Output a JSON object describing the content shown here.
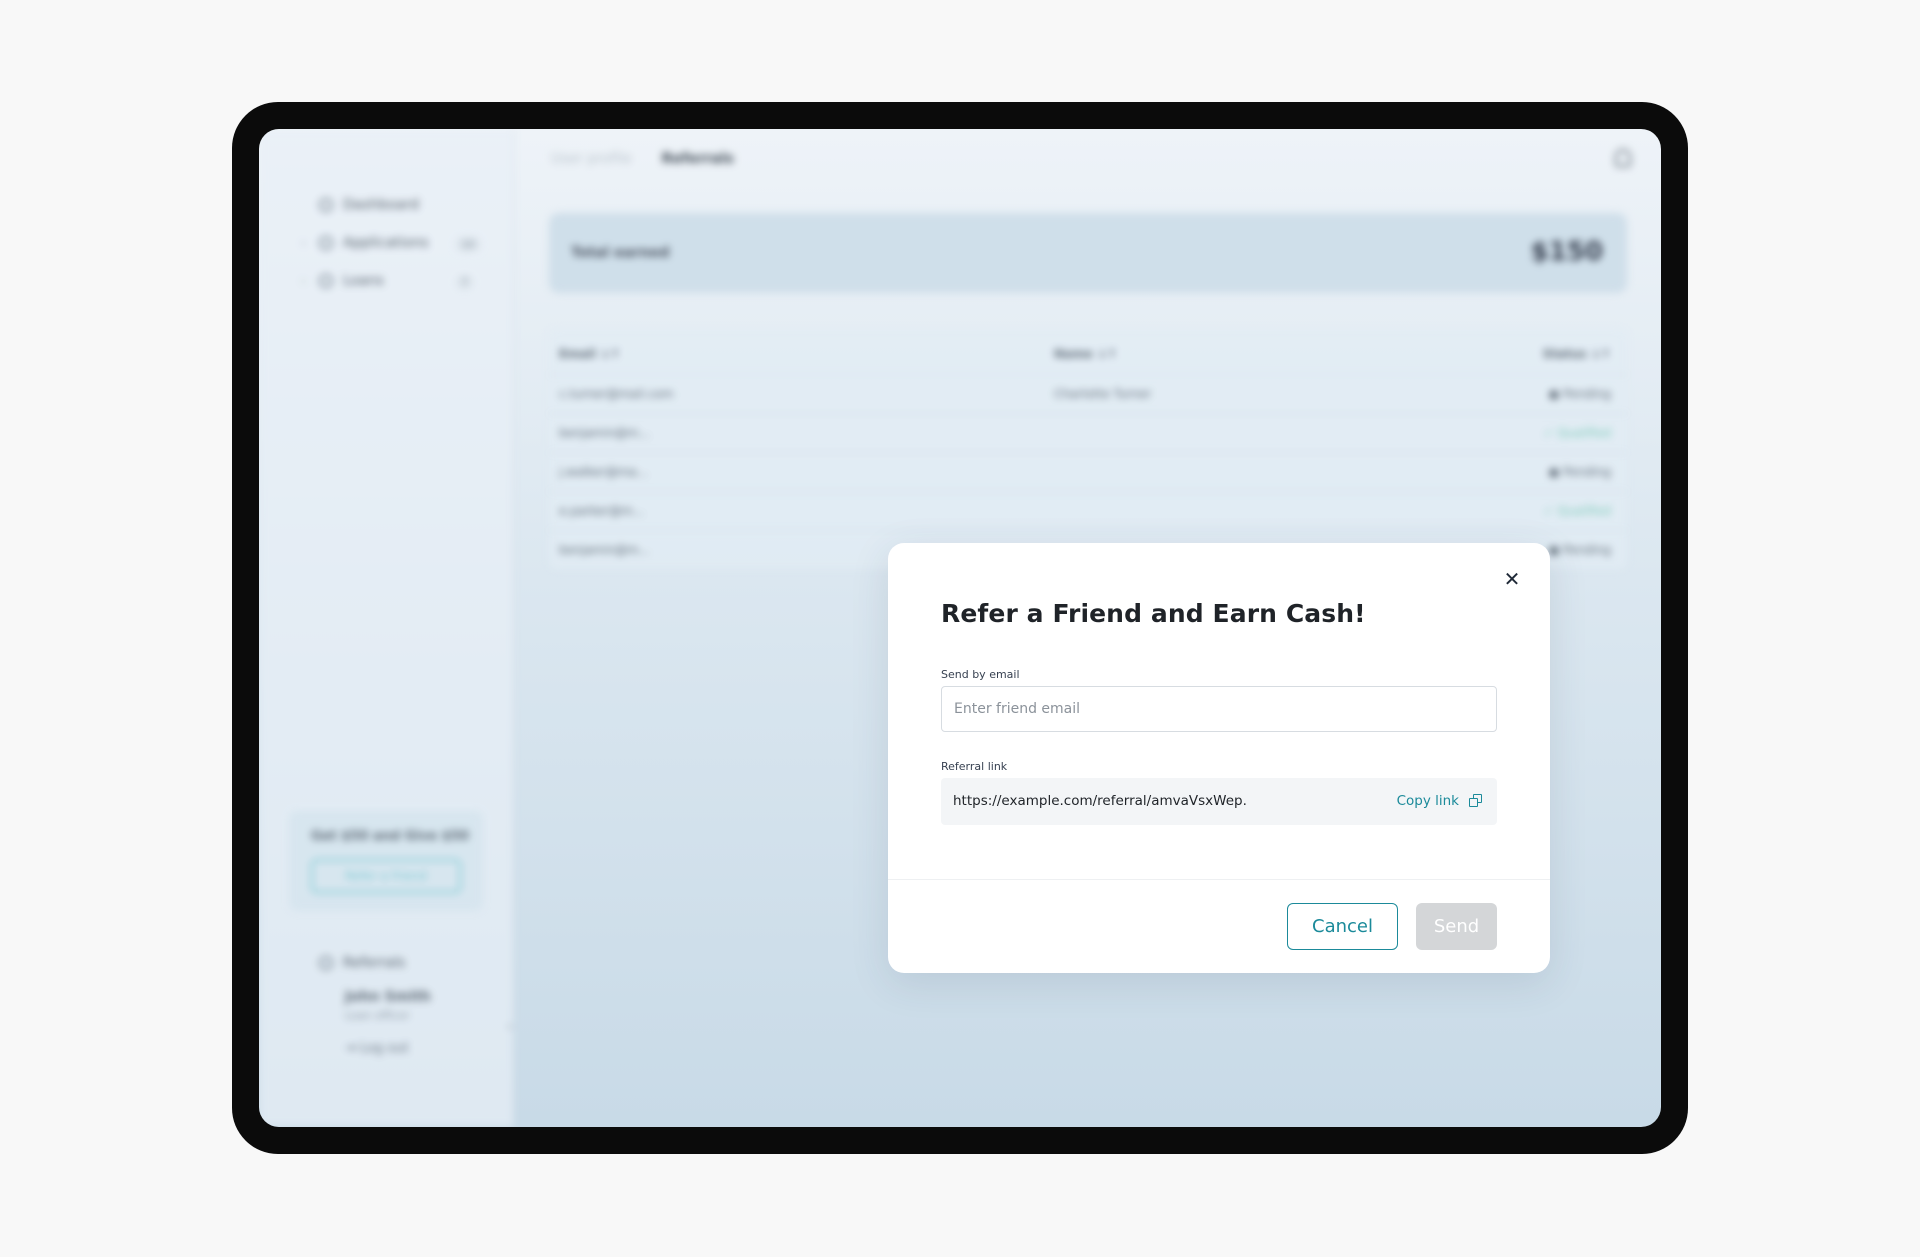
{
  "sidebar": {
    "items": [
      {
        "label": "Dashboard",
        "count": ""
      },
      {
        "label": "Applications",
        "count": "10"
      },
      {
        "label": "Loans",
        "count": "7"
      }
    ],
    "promo": {
      "title": "Get $50 and Give $50",
      "button": "Refer a friend"
    },
    "referrals_label": "Referrals",
    "user": {
      "name": "John Smith",
      "role": "Loan officer"
    },
    "logout_label": "Log out"
  },
  "header": {
    "breadcrumb": [
      "User profile",
      "Referrals"
    ]
  },
  "summary": {
    "label": "Total earned",
    "value": "$150"
  },
  "table": {
    "columns": [
      "Email",
      "Name",
      "Status"
    ],
    "rows": [
      {
        "email": "c.turner@mail.com",
        "name": "Charlotte Turner",
        "status": "Pending"
      },
      {
        "email": "benjamin@m...",
        "name": "",
        "status": "Qualified"
      },
      {
        "email": "j.walker@ma...",
        "name": "",
        "status": "Pending"
      },
      {
        "email": "e.parker@m...",
        "name": "",
        "status": "Qualified"
      },
      {
        "email": "benjamin@m...",
        "name": "",
        "status": "Pending"
      }
    ]
  },
  "modal": {
    "title": "Refer a Friend and Earn Cash!",
    "email_label": "Send by email",
    "email_placeholder": "Enter friend email",
    "email_value": "",
    "link_label": "Referral link",
    "link_value": "https://example.com/referral/amvaVsxWep.",
    "copy_label": "Copy link",
    "cancel_label": "Cancel",
    "send_label": "Send"
  },
  "colors": {
    "accent": "#1b8a9a",
    "disabled_button": "#d4d6d8",
    "device_frame": "#0b0b0b"
  },
  "icons": [
    "dashboard-icon",
    "applications-icon",
    "loans-icon",
    "referrals-icon",
    "bell-icon",
    "close-icon",
    "copy-icon",
    "logout-icon"
  ]
}
